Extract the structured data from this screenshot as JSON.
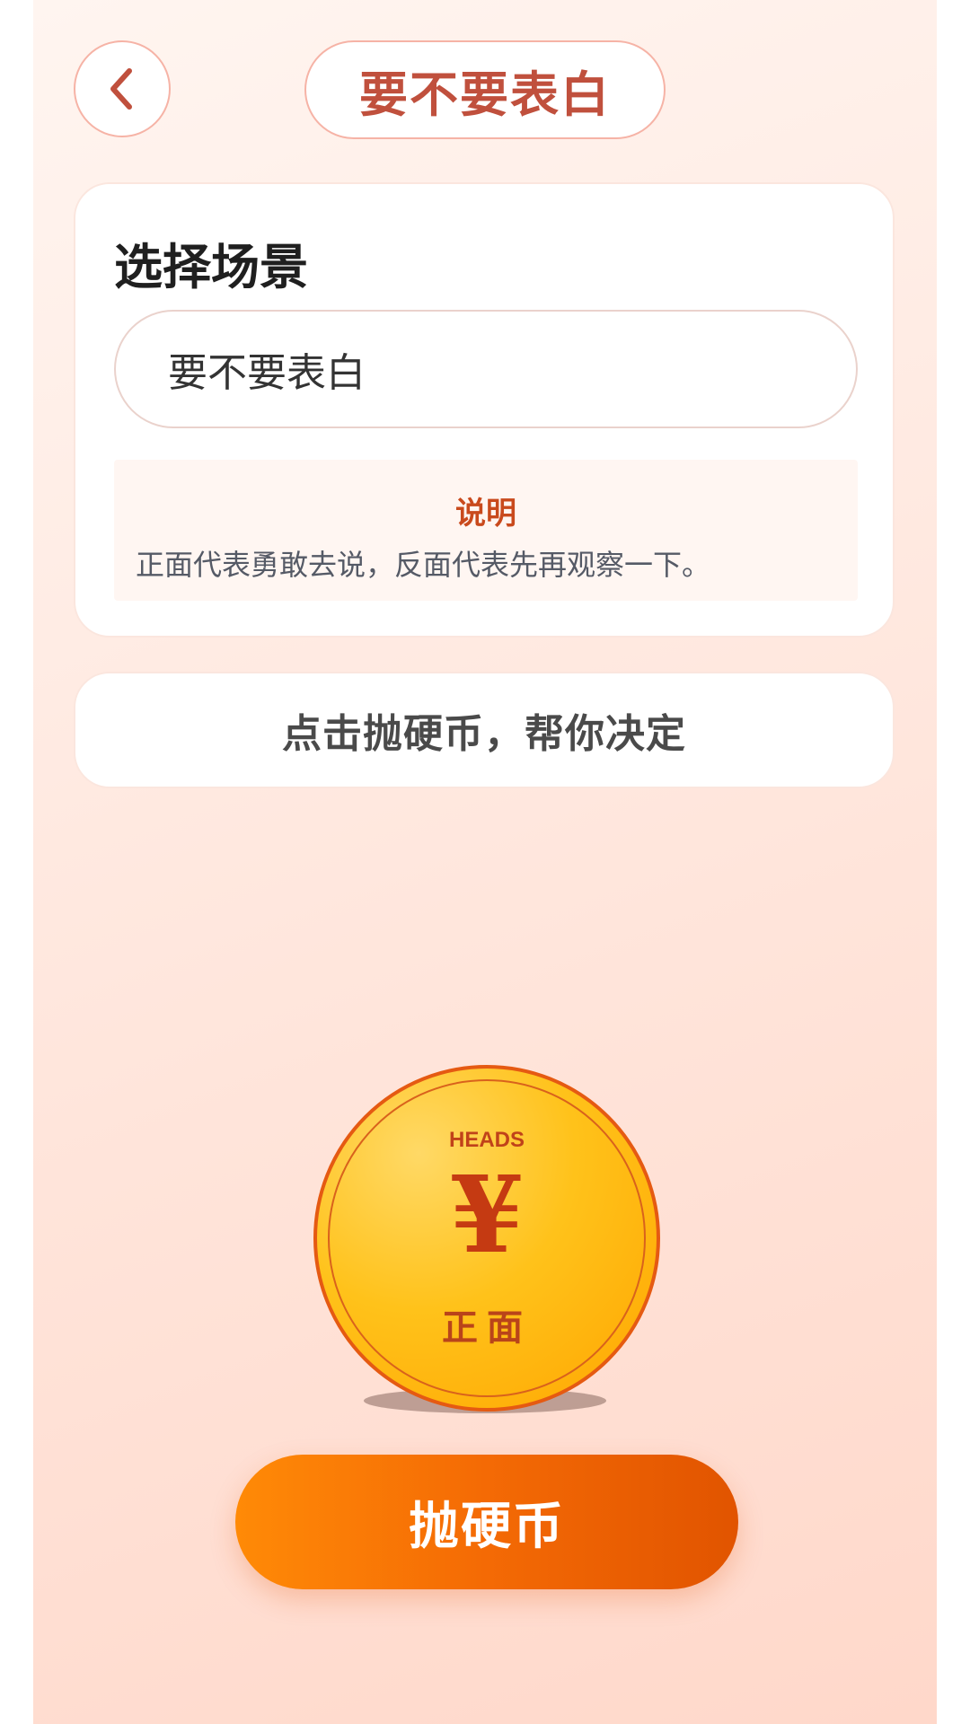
{
  "header": {
    "title": "要不要表白",
    "back_icon": "chevron-left-icon"
  },
  "scene_card": {
    "heading": "选择场景",
    "input_value": "要不要表白",
    "description_title": "说明",
    "description_text": "正面代表勇敢去说，反面代表先再观察一下。"
  },
  "hint": {
    "text": "点击抛硬币，帮你决定"
  },
  "coin": {
    "top_label": "HEADS",
    "symbol": "¥",
    "face_label": "正面"
  },
  "action": {
    "flip_label": "抛硬币"
  },
  "colors": {
    "accent": "#c0503d",
    "button": "#f46a05",
    "coin": "#ffc21a",
    "coin_edge": "#e55a12"
  }
}
